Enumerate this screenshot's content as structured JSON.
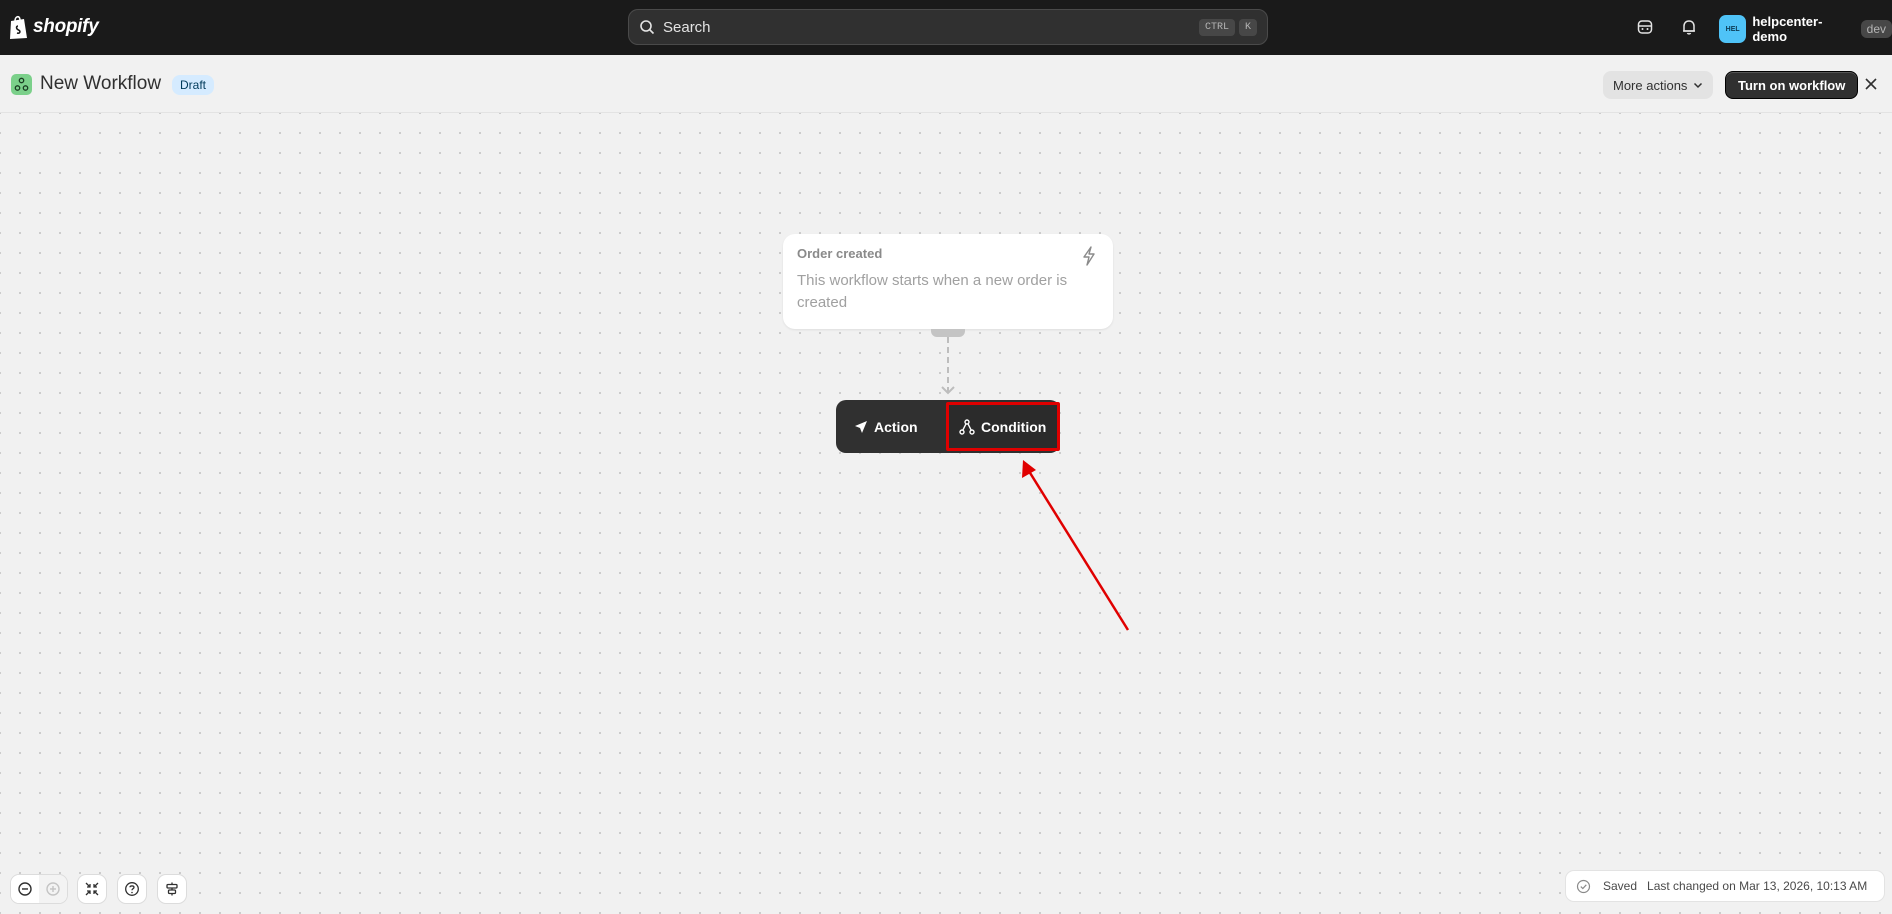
{
  "topbar": {
    "brand": "shopify",
    "search_label": "Search",
    "shortcut_keys": [
      "CTRL",
      "K"
    ],
    "avatar_initials": "HEL",
    "store_name": "helpcenter-demo",
    "env_badge": "dev"
  },
  "header": {
    "title": "New Workflow",
    "status_badge": "Draft",
    "more_actions_label": "More actions",
    "primary_label": "Turn on workflow"
  },
  "trigger": {
    "title": "Order created",
    "description": "This workflow starts when a new order is created",
    "icon": "bolt-icon"
  },
  "step_menu": {
    "action_label": "Action",
    "condition_label": "Condition"
  },
  "status": {
    "saved_label": "Saved",
    "last_changed": "Last changed on Mar 13, 2026, 10:13 AM"
  },
  "colors": {
    "highlight": "#e00000",
    "topbar_bg": "#1a1a1a",
    "draft_badge_bg": "#d5ebff",
    "avatar_bg": "#4fc3f7"
  }
}
